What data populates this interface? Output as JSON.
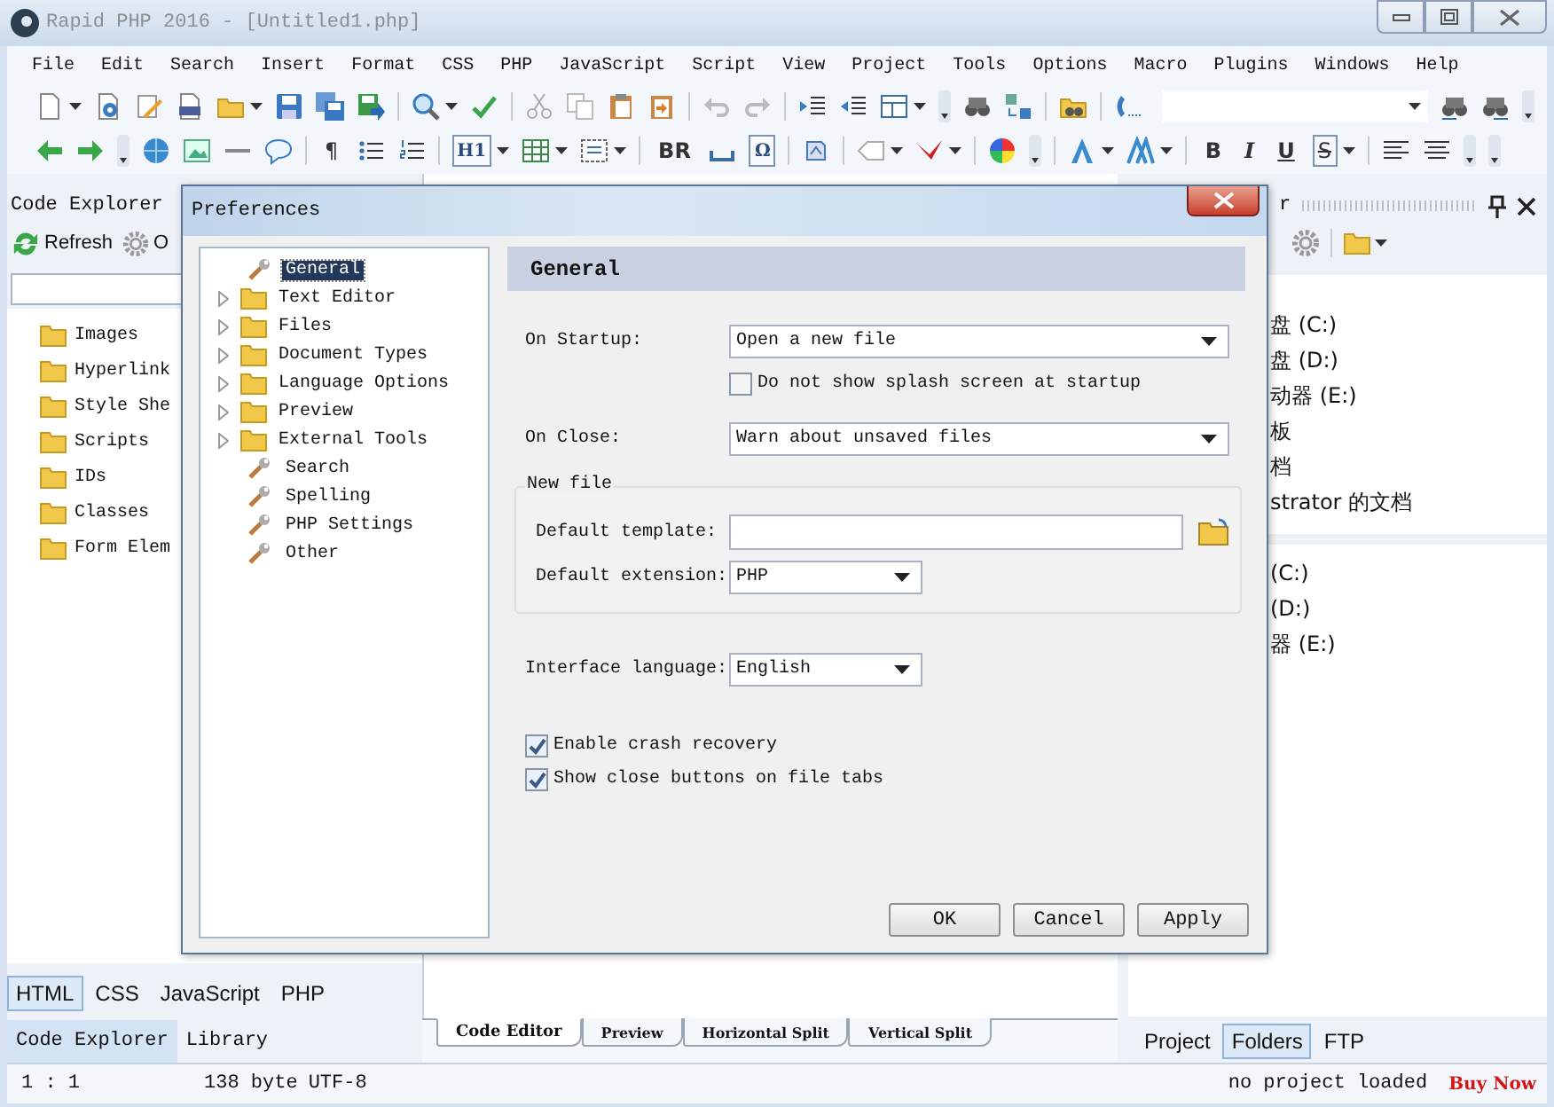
{
  "window": {
    "title": "Rapid PHP 2016 - [Untitled1.php]"
  },
  "menu": [
    "File",
    "Edit",
    "Search",
    "Insert",
    "Format",
    "CSS",
    "PHP",
    "JavaScript",
    "Script",
    "View",
    "Project",
    "Tools",
    "Options",
    "Macro",
    "Plugins",
    "Windows",
    "Help"
  ],
  "format_toolbar": {
    "buttons": [
      "¶",
      "H1",
      "BR",
      "Ω",
      "B",
      "I",
      "U",
      "S"
    ]
  },
  "left_panel": {
    "title": "Code Explorer",
    "toolbar": [
      "Refresh",
      "O"
    ],
    "tree": [
      {
        "label": "Images"
      },
      {
        "label": "Hyperlink"
      },
      {
        "label": "Style She"
      },
      {
        "label": "Scripts"
      },
      {
        "label": "IDs"
      },
      {
        "label": "Classes"
      },
      {
        "label": "Form Elem"
      }
    ],
    "language_tabs": [
      {
        "label": "HTML",
        "selected": true
      },
      {
        "label": "CSS",
        "selected": false
      },
      {
        "label": "JavaScript",
        "selected": false
      },
      {
        "label": "PHP",
        "selected": false
      }
    ],
    "panel_tabs": [
      {
        "label": "Code Explorer",
        "selected": true
      },
      {
        "label": "Library",
        "selected": false
      }
    ]
  },
  "editor_tabs": [
    {
      "label": "Code Editor",
      "selected": true
    },
    {
      "label": "Preview",
      "selected": false
    },
    {
      "label": "Horizontal Split",
      "selected": false
    },
    {
      "label": "Vertical Split",
      "selected": false
    }
  ],
  "right_panel": {
    "title": "r",
    "drives": [
      "盘 (C:)",
      "盘 (D:)",
      "动器 (E:)",
      "板",
      "档",
      "strator 的文档"
    ],
    "drives_2": [
      "(C:)",
      "(D:)",
      "器 (E:)"
    ],
    "tabs": [
      {
        "label": "Project",
        "selected": false
      },
      {
        "label": "Folders",
        "selected": true
      },
      {
        "label": "FTP",
        "selected": false
      }
    ]
  },
  "status_bar": {
    "position": "1 : 1",
    "size": "138 byte",
    "encoding": "UTF-8",
    "project": "no project loaded",
    "promo": "Buy Now"
  },
  "dialog": {
    "title": "Preferences",
    "tree": [
      {
        "label": "General",
        "kind": "page",
        "selected": true
      },
      {
        "label": "Text Editor",
        "kind": "folder",
        "selected": false
      },
      {
        "label": "Files",
        "kind": "folder",
        "selected": false
      },
      {
        "label": "Document Types",
        "kind": "folder",
        "selected": false
      },
      {
        "label": "Language Options",
        "kind": "folder",
        "selected": false
      },
      {
        "label": "Preview",
        "kind": "folder",
        "selected": false
      },
      {
        "label": "External Tools",
        "kind": "folder",
        "selected": false
      },
      {
        "label": "Search",
        "kind": "page",
        "selected": false
      },
      {
        "label": "Spelling",
        "kind": "page",
        "selected": false
      },
      {
        "label": "PHP Settings",
        "kind": "page",
        "selected": false
      },
      {
        "label": "Other",
        "kind": "page",
        "selected": false
      }
    ],
    "page_title": "General",
    "on_startup": {
      "label": "On Startup:",
      "value": "Open a new file"
    },
    "splash": {
      "label": "Do not show splash screen at startup",
      "checked": false
    },
    "on_close": {
      "label": "On Close:",
      "value": "Warn about unsaved files"
    },
    "new_file": {
      "legend": "New file",
      "template": {
        "label": "Default template:"
      },
      "extension": {
        "label": "Default extension:",
        "value": "PHP"
      }
    },
    "interface_language": {
      "label": "Interface language:",
      "value": "English"
    },
    "options": [
      {
        "label": "Enable crash recovery",
        "checked": true
      },
      {
        "label": "Show close buttons on file tabs",
        "checked": true
      }
    ],
    "buttons": [
      "OK",
      "Cancel",
      "Apply"
    ]
  }
}
